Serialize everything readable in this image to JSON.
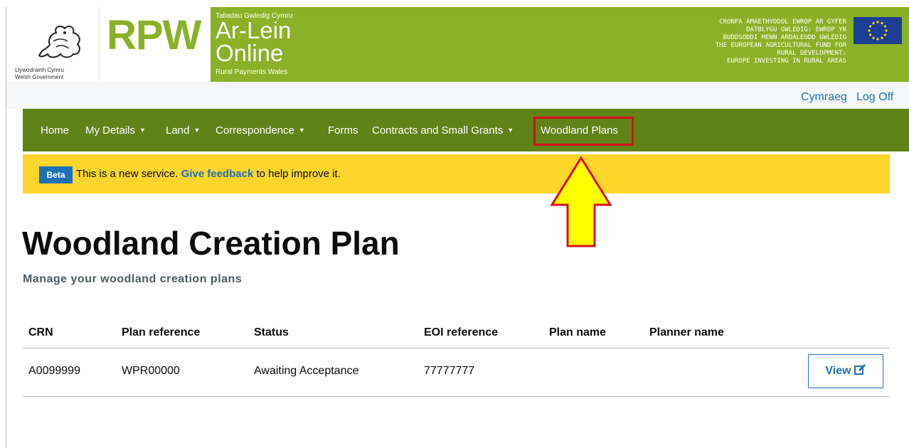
{
  "header": {
    "wg_line1": "Llywodraeth Cymru",
    "wg_line2": "Welsh Government",
    "rpw_logo": "RPW",
    "welsh_small": "Taliadau Gwledig Cymru",
    "arlein": "Ar-Lein",
    "online": "Online",
    "rural_payments": "Rural Payments Wales",
    "eu_lines": [
      "CRONFA AMAETHYDDOL EWROP AR GYFER",
      "DATBLYGU GWLEDIG: EWROP YN",
      "BUDDSODDI MEWN ARDALEODD GWLEDIG",
      "THE EUROPEAN AGRICULTURAL FUND FOR",
      "RURAL DEVELOPMENT:",
      "EUROPE INVESTING IN RURAL AREAS"
    ],
    "eu_flag_icon": "eu-flag-icon",
    "dragon_icon": "welsh-dragon-icon"
  },
  "lang_bar": {
    "cymraeg": "Cymraeg",
    "log_off": "Log Off"
  },
  "nav": {
    "items": [
      {
        "label": "Home",
        "dropdown": false
      },
      {
        "label": "My Details",
        "dropdown": true
      },
      {
        "label": "Land",
        "dropdown": true
      },
      {
        "label": "Correspondence",
        "dropdown": true
      },
      {
        "label": "Forms",
        "dropdown": false
      },
      {
        "label": "Contracts and Small Grants",
        "dropdown": true
      },
      {
        "label": "Woodland Plans",
        "dropdown": false
      }
    ],
    "caret": "▼"
  },
  "beta": {
    "tag": "Beta",
    "text_before": "This is a new service.",
    "link": "Give feedback",
    "text_after": "to help improve it."
  },
  "page": {
    "title": "Woodland Creation Plan",
    "subtitle": "Manage your woodland creation plans"
  },
  "table": {
    "headers": [
      "CRN",
      "Plan reference",
      "Status",
      "EOI reference",
      "Plan name",
      "Planner name"
    ],
    "rows": [
      {
        "crn": "A0099999",
        "plan_reference": "WPR00000",
        "status": "Awaiting Acceptance",
        "eoi_reference": "77777777",
        "plan_name": "",
        "planner_name": "",
        "action": "View"
      }
    ]
  },
  "colors": {
    "brand_green": "#8ab127",
    "nav_green": "#5f8318",
    "beta_yellow": "#fed52b",
    "link_blue": "#1d70b8",
    "highlight_red": "#d4101a",
    "arrow_yellow": "#ffff00"
  }
}
